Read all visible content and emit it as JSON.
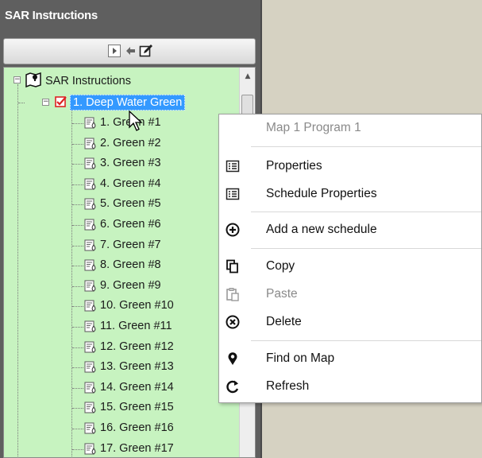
{
  "panel": {
    "title": "SAR Instructions"
  },
  "tree": {
    "root": "SAR Instructions",
    "program": "1. Deep Water Green",
    "schedules": [
      "1. Green #1",
      "2. Green #2",
      "3. Green #3",
      "4. Green #4",
      "5. Green #5",
      "6. Green #6",
      "7. Green #7",
      "8. Green #8",
      "9. Green #9",
      "10. Green #10",
      "11. Green #11",
      "12. Green #12",
      "13. Green #13",
      "14. Green #14",
      "15. Green #15",
      "16. Green #16",
      "17. Green #17"
    ]
  },
  "context_menu": {
    "header": "Map 1 Program 1",
    "properties": "Properties",
    "schedule_properties": "Schedule Properties",
    "add_schedule": "Add a new schedule",
    "copy": "Copy",
    "paste": "Paste",
    "delete": "Delete",
    "find_on_map": "Find on Map",
    "refresh": "Refresh"
  },
  "colors": {
    "tree_bg": "#c7f3c0",
    "selection": "#3399ff",
    "panel_bg": "#5f5f5f"
  }
}
